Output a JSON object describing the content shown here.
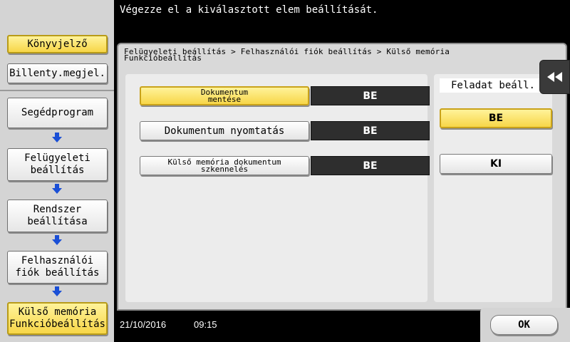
{
  "header": {
    "message": "Végezze el a kiválasztott elem beállítását."
  },
  "sidebar": {
    "bookmark_label": "Könyvjelző",
    "keyboard_label": "Billenty.megjel.",
    "path": [
      {
        "label": "Segédprogram"
      },
      {
        "label": "Felügyeleti\nbeállítás"
      },
      {
        "label": "Rendszer\nbeállítása"
      },
      {
        "label": "Felhasználói\nfiók beállítás"
      },
      {
        "label": "Külső memória\nFunkcióbeállítás"
      }
    ]
  },
  "breadcrumb": {
    "line1": "Felügyeleti beállítás > Felhasználói fiók beállítás > Külső memória",
    "line2": "Funkcióbeállítás"
  },
  "functions": [
    {
      "label": "Dokumentum\nmentése",
      "value": "BE",
      "selected": true
    },
    {
      "label": "Dokumentum nyomtatás",
      "value": "BE",
      "selected": false
    },
    {
      "label": "Külső memória dokumentum\nszkennelés",
      "value": "BE",
      "selected": false
    }
  ],
  "right_panel": {
    "title": "Feladat beáll.",
    "on_label": "BE",
    "off_label": "KI",
    "selected": "BE"
  },
  "status": {
    "date": "21/10/2016",
    "time": "09:15"
  },
  "ok_label": "OK",
  "colors": {
    "highlight": "#f7d648",
    "value_bg": "#2e2e2e",
    "arrow": "#1a4fd6"
  },
  "icons": {
    "collapse": "double-chevron-left-icon",
    "step_arrow": "arrow-down-icon"
  }
}
